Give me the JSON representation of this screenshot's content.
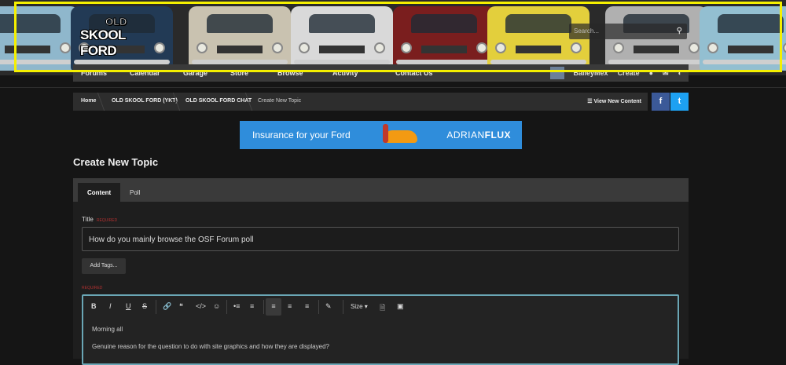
{
  "header": {
    "logo_line1": "OLD",
    "logo_line2": "SKOOL FORD",
    "search_placeholder": "Search...",
    "highlight_color": "#f5f000"
  },
  "cars": [
    {
      "color": "#8fb7cc"
    },
    {
      "color": "#223a55"
    },
    {
      "color": "#c9c2b0"
    },
    {
      "color": "#d9d9d9"
    },
    {
      "color": "#7a1e1e"
    },
    {
      "color": "#e3cf3c"
    },
    {
      "color": "#b0b0b0"
    },
    {
      "color": "#93bfd1"
    }
  ],
  "nav": {
    "items": [
      "Forums",
      "Calendar",
      "Garage",
      "Store",
      "Browse",
      "Activity",
      "Contact Us"
    ],
    "user": "BaileyMex",
    "create": "Create"
  },
  "breadcrumb": {
    "items": [
      "Home",
      "OLD SKOOL FORD (YKT)",
      "OLD SKOOL FORD CHAT",
      "Create New Topic"
    ],
    "view_new": "View New Content"
  },
  "ad": {
    "text": "Insurance for your Ford",
    "brand_a": "ADRIAN",
    "brand_b": "FLUX"
  },
  "page_title": "Create New Topic",
  "tabs": [
    "Content",
    "Poll"
  ],
  "form": {
    "title_label": "Title",
    "required": "REQUIRED",
    "title_value": "How do you mainly browse the OSF Forum poll",
    "tags_button": "Add Tags...",
    "editor_required": "REQUIRED",
    "size_label": "Size",
    "body_line1": "Morning all",
    "body_line2": "Genuine reason for the question to do with site graphics and how they are displayed?"
  }
}
